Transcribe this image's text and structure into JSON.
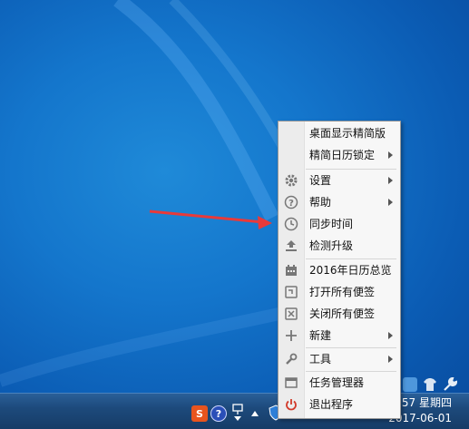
{
  "menu": {
    "items": [
      {
        "label": "桌面显示精简版",
        "icon": "none",
        "submenu": false
      },
      {
        "label": "精简日历锁定",
        "icon": "none",
        "submenu": true
      },
      {
        "label": "设置",
        "icon": "gear-icon",
        "submenu": true
      },
      {
        "label": "帮助",
        "icon": "question-icon",
        "submenu": true
      },
      {
        "label": "同步时间",
        "icon": "clock-icon",
        "submenu": false
      },
      {
        "label": "检测升级",
        "icon": "upload-icon",
        "submenu": false
      },
      {
        "label": "2016年日历总览",
        "icon": "calendar-icon",
        "submenu": false
      },
      {
        "label": "打开所有便签",
        "icon": "note-open-icon",
        "submenu": false
      },
      {
        "label": "关闭所有便签",
        "icon": "note-close-icon",
        "submenu": false
      },
      {
        "label": "新建",
        "icon": "plus-icon",
        "submenu": true
      },
      {
        "label": "工具",
        "icon": "wrench-icon",
        "submenu": true
      },
      {
        "label": "任务管理器",
        "icon": "window-icon",
        "submenu": false
      },
      {
        "label": "退出程序",
        "icon": "power-icon",
        "submenu": false
      }
    ]
  },
  "taskbar": {
    "clock_time": "57 星期四",
    "clock_date": "2017-06-01",
    "tray_sogou_letter": "S"
  },
  "colors": {
    "desktop": "#1476cc",
    "arrow": "#e83a3a",
    "menu_bg": "#f7f7f7",
    "power_red": "#d23a2a"
  }
}
